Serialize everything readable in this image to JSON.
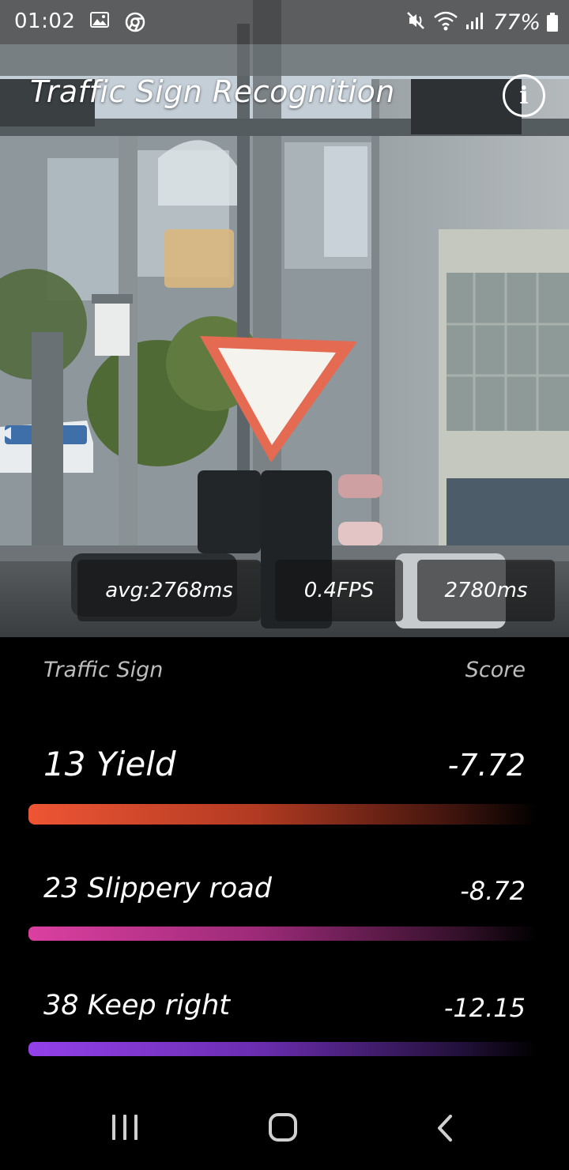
{
  "status_bar": {
    "time": "01:02",
    "battery": "77%",
    "icons": [
      "gallery-icon",
      "chrome-icon",
      "mute-icon",
      "wifi-icon",
      "signal-icon",
      "battery-icon"
    ]
  },
  "app_bar": {
    "title": "Traffic Sign Recognition",
    "info_icon": "info-icon"
  },
  "stats": {
    "avg": "avg:2768ms",
    "fps": "0.4FPS",
    "latency": "2780ms"
  },
  "results": {
    "header_label": "Traffic Sign",
    "header_score": "Score",
    "items": [
      {
        "label": "13 Yield",
        "score": "-7.72",
        "color": "#e8502a"
      },
      {
        "label": "23  Slippery road",
        "score": "-8.72",
        "color": "#d33f9a"
      },
      {
        "label": "38  Keep right",
        "score": "-12.15",
        "color": "#8a3fe0"
      }
    ]
  },
  "nav_bar": {
    "icons": [
      "recents-icon",
      "home-icon",
      "back-icon"
    ]
  }
}
